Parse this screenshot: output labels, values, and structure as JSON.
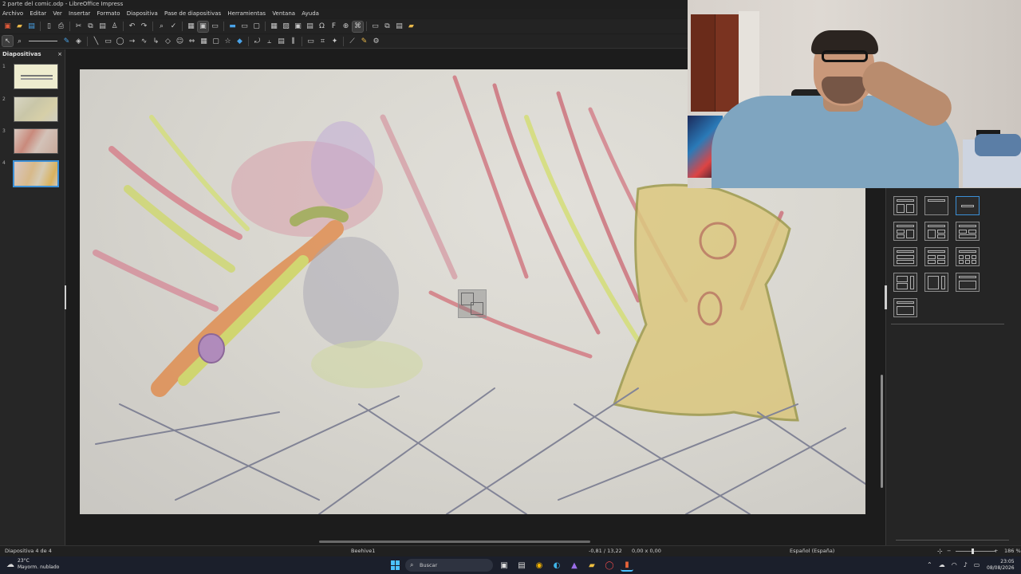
{
  "window": {
    "title": "2 parte del comic.odp - LibreOffice Impress"
  },
  "menu": [
    "Archivo",
    "Editar",
    "Ver",
    "Insertar",
    "Formato",
    "Diapositiva",
    "Pase de diapositivas",
    "Herramientas",
    "Ventana",
    "Ayuda"
  ],
  "slides_panel": {
    "title": "Diapositivas",
    "close": "×",
    "slides": [
      {
        "num": "1"
      },
      {
        "num": "2"
      },
      {
        "num": "3"
      },
      {
        "num": "4"
      }
    ],
    "active_index": 4
  },
  "statusbar": {
    "slide_info": "Diapositiva 4 de 4",
    "master": "Beehive1",
    "position": "-0,81 / 13,22",
    "size": "0,00 x 0,00",
    "language": "Español (España)",
    "zoom": "186 %"
  },
  "taskbar": {
    "weather_temp": "23°C",
    "weather_desc": "Mayorm. nublado",
    "search_placeholder": "Buscar",
    "time": "23:05",
    "date": "08/08/2026"
  },
  "colors": {
    "accent": "#3b8fd6",
    "app_bg": "#1e1e1e",
    "taskbar_bg": "#1b1f2b"
  }
}
